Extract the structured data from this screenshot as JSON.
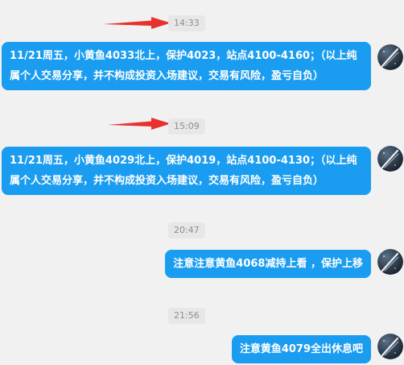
{
  "colors": {
    "background": "#f1f1f1",
    "bubble": "#1a9cf0",
    "bubble_text": "#ffffff",
    "timestamp_bg": "#e7e7e7",
    "timestamp_text": "#8e8e8e",
    "arrow": "#e8302f"
  },
  "messages": [
    {
      "time": "14:33",
      "text": "11/21周五，小黄鱼4033北上，保护4023，站点4100-4160；（以上纯属个人交易分享，并不构成投资入场建议，交易有风险，盈亏自负）",
      "avatar_icon": "starry-night-avatar-icon",
      "has_arrow": true
    },
    {
      "time": "15:09",
      "text": "11/21周五，小黄鱼4029北上，保护4019，站点4100-4130；（以上纯属个人交易分享，并不构成投资入场建议，交易有风险，盈亏自负）",
      "avatar_icon": "starry-night-avatar-icon",
      "has_arrow": true
    },
    {
      "time": "20:47",
      "text": "注意注意黄鱼4068减持上看 ，保护上移",
      "avatar_icon": "starry-night-avatar-icon",
      "has_arrow": false
    },
    {
      "time": "21:56",
      "text": "注意黄鱼4079全出休息吧",
      "avatar_icon": "starry-night-avatar-icon",
      "has_arrow": false
    }
  ]
}
